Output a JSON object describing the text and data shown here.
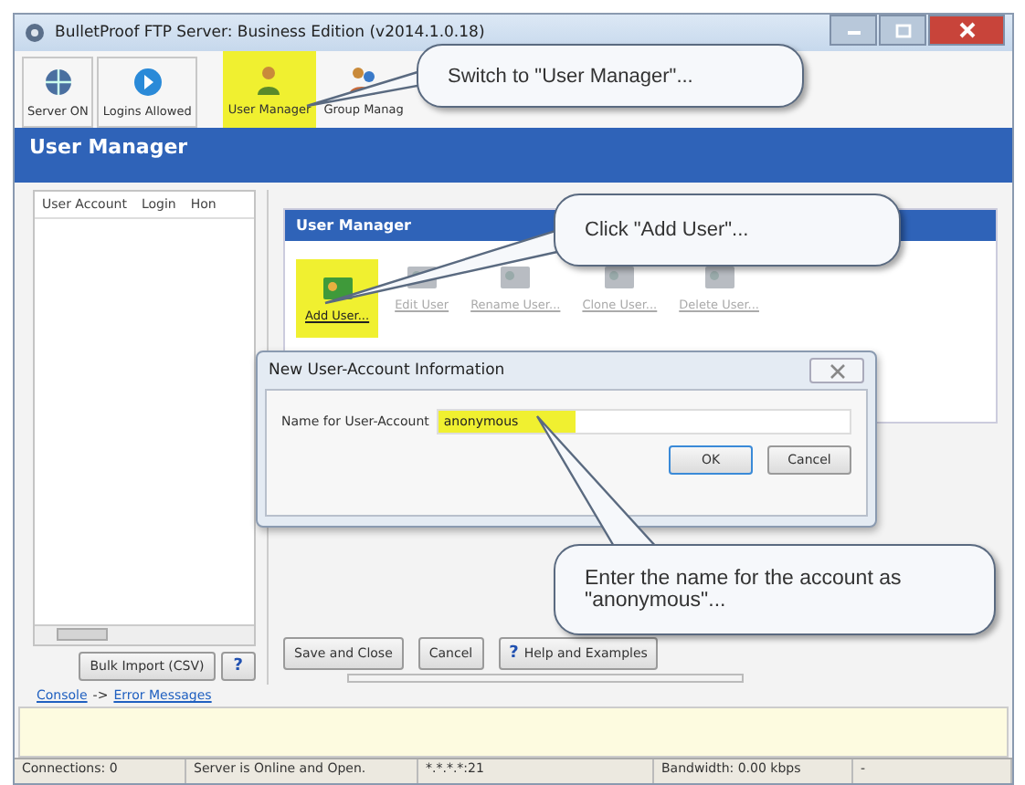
{
  "window": {
    "title": "BulletProof FTP Server: Business Edition (v2014.1.0.18)"
  },
  "toolbar": {
    "items": [
      {
        "label": "Server ON",
        "kind": "server",
        "highlighted": false
      },
      {
        "label": "Logins Allowed",
        "kind": "play",
        "highlighted": false
      },
      {
        "label": "User Manager",
        "kind": "user",
        "highlighted": true
      },
      {
        "label": "Group Manag",
        "kind": "group",
        "highlighted": false
      }
    ]
  },
  "header": {
    "title": "User Manager"
  },
  "user_list": {
    "columns": [
      "User Account",
      "Login",
      "Hon"
    ],
    "buttons": [
      "Bulk Import (CSV)",
      "?"
    ]
  },
  "user_panel": {
    "title": "User Manager",
    "actions": [
      {
        "label": "Add User...",
        "disabled": false,
        "highlighted": true
      },
      {
        "label": "Edit User",
        "disabled": true,
        "highlighted": false
      },
      {
        "label": "Rename User...",
        "disabled": true,
        "highlighted": false
      },
      {
        "label": "Clone User...",
        "disabled": true,
        "highlighted": false
      },
      {
        "label": "Delete User...",
        "disabled": true,
        "highlighted": false
      }
    ]
  },
  "bottom_buttons": [
    {
      "label": "Save and Close",
      "kind": "plain"
    },
    {
      "label": "Cancel",
      "kind": "plain"
    },
    {
      "label": "Help and Examples",
      "kind": "help",
      "icon": "?"
    }
  ],
  "console": {
    "link": "Console",
    "separator": "->",
    "target": "Error Messages"
  },
  "status_bar": [
    "Connections: 0",
    "Server is Online and Open.",
    "*.*.*.*:21",
    "Bandwidth: 0.00 kbps",
    "-"
  ],
  "dialog": {
    "title": "New User-Account Information",
    "field_label": "Name for User-Account",
    "value": "anonymous",
    "value_highlighted": true,
    "buttons": [
      "OK",
      "Cancel"
    ]
  },
  "callouts": [
    "Switch to \"User Manager\"...",
    "Click \"Add User\"...",
    "Enter the name for the account as \"anonymous\"..."
  ]
}
